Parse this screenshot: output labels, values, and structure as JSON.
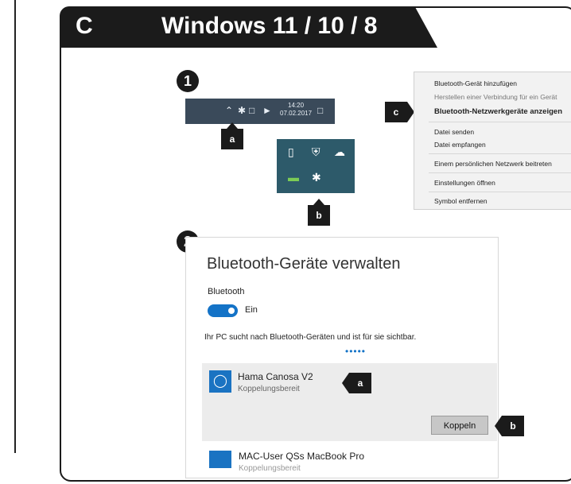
{
  "header": {
    "letter": "C",
    "title": "Windows 11 / 10 / 8"
  },
  "step1": {
    "number": "1",
    "taskbar": {
      "time": "14:20",
      "date": "07.02.2017",
      "icons": [
        "chevron-up-icon",
        "bluetooth-icon",
        "network-icon",
        "speaker-icon",
        "notification-icon"
      ]
    },
    "tag_a": "a",
    "tag_b": "b",
    "tag_c": "c",
    "tray_icons": [
      "usb-icon",
      "shield-icon",
      "cloud-icon",
      "battery-icon",
      "bluetooth-icon"
    ],
    "context_menu": [
      "Bluetooth-Gerät hinzufügen",
      "Herstellen einer Verbindung für ein Gerät",
      "Bluetooth-Netzwerkgeräte anzeigen",
      "Datei senden",
      "Datei empfangen",
      "Einem persönlichen Netzwerk beitreten",
      "Einstellungen öffnen",
      "Symbol entfernen"
    ]
  },
  "step2": {
    "number": "2",
    "title": "Bluetooth-Geräte verwalten",
    "bt_label": "Bluetooth",
    "toggle_label": "Ein",
    "toggle_on": true,
    "description": "Ihr PC sucht nach Bluetooth-Geräten und ist für sie sichtbar.",
    "dots": "•••••",
    "device1": {
      "name": "Hama Canosa V2",
      "status": "Koppelungsbereit"
    },
    "pair_button": "Koppeln",
    "device2": {
      "name": "MAC-User QSs MacBook Pro",
      "status": "Koppelungsbereit"
    },
    "tag_a": "a",
    "tag_b": "b"
  },
  "colors": {
    "dark": "#1b1b1b",
    "accent": "#1473c7",
    "taskbar": "#3a4a5a",
    "tray": "#2d5a6a"
  }
}
